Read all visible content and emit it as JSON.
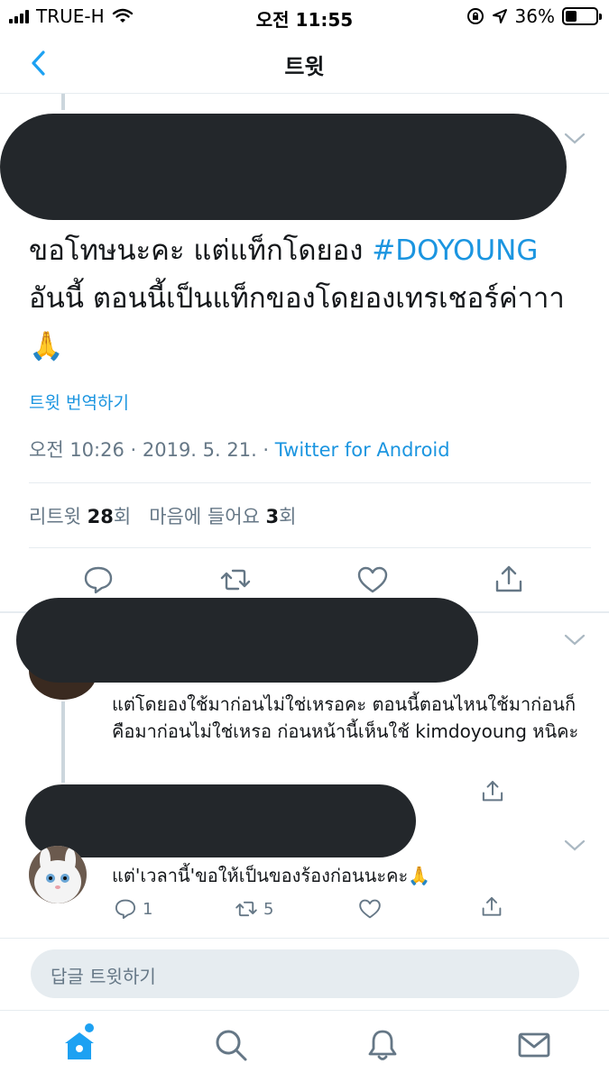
{
  "status_bar": {
    "carrier": "TRUE-H",
    "time": "오전 11:55",
    "battery": "36%"
  },
  "nav": {
    "title": "트윗"
  },
  "main_tweet": {
    "text_line1": "ขอโทษนะคะ แต่แท็กโดยอง ",
    "hashtag": "#DOYOUNG",
    "text_line2": "อันนี้ ตอนนี้เป็นแท็กของโดยองเทรเชอร์ค่าาา",
    "text_line3": "🙏",
    "translate_label": "트윗 번역하기",
    "timestamp": "오전 10:26 · 2019. 5. 21. · ",
    "source": "Twitter for Android",
    "retweets_label": "리트윗 ",
    "retweets_count": "28",
    "retweets_suffix": "회",
    "likes_label": "마음에 들어요 ",
    "likes_count": "3",
    "likes_suffix": "회"
  },
  "replies": [
    {
      "text": "แต่โดยองใช้มาก่อนไม่ใช่เหรอคะ ตอนนี้ตอนไหนใช้มาก่อนก็คือมาก่อนไม่ใช่เหรอ ก่อนหน้านี้เห็นใช้ kimdoyoung หนิคะ"
    },
    {
      "text": "แต่'เวลานี้'ขอให้เป็นของร้องก่อนนะคะ🙏",
      "reply_count": "1",
      "retweet_count": "5"
    }
  ],
  "compose": {
    "placeholder": "답글 트윗하기"
  },
  "icons": {
    "back": "chevron-left-icon",
    "reply": "speech-bubble-icon",
    "retweet": "retweet-icon",
    "like": "heart-icon",
    "share": "share-icon",
    "home": "home-icon",
    "search": "search-icon",
    "notifications": "bell-icon",
    "messages": "mail-icon"
  },
  "colors": {
    "accent": "#1da1f2",
    "link": "#1b95e0",
    "muted": "#657786",
    "redaction": "#23272b"
  }
}
